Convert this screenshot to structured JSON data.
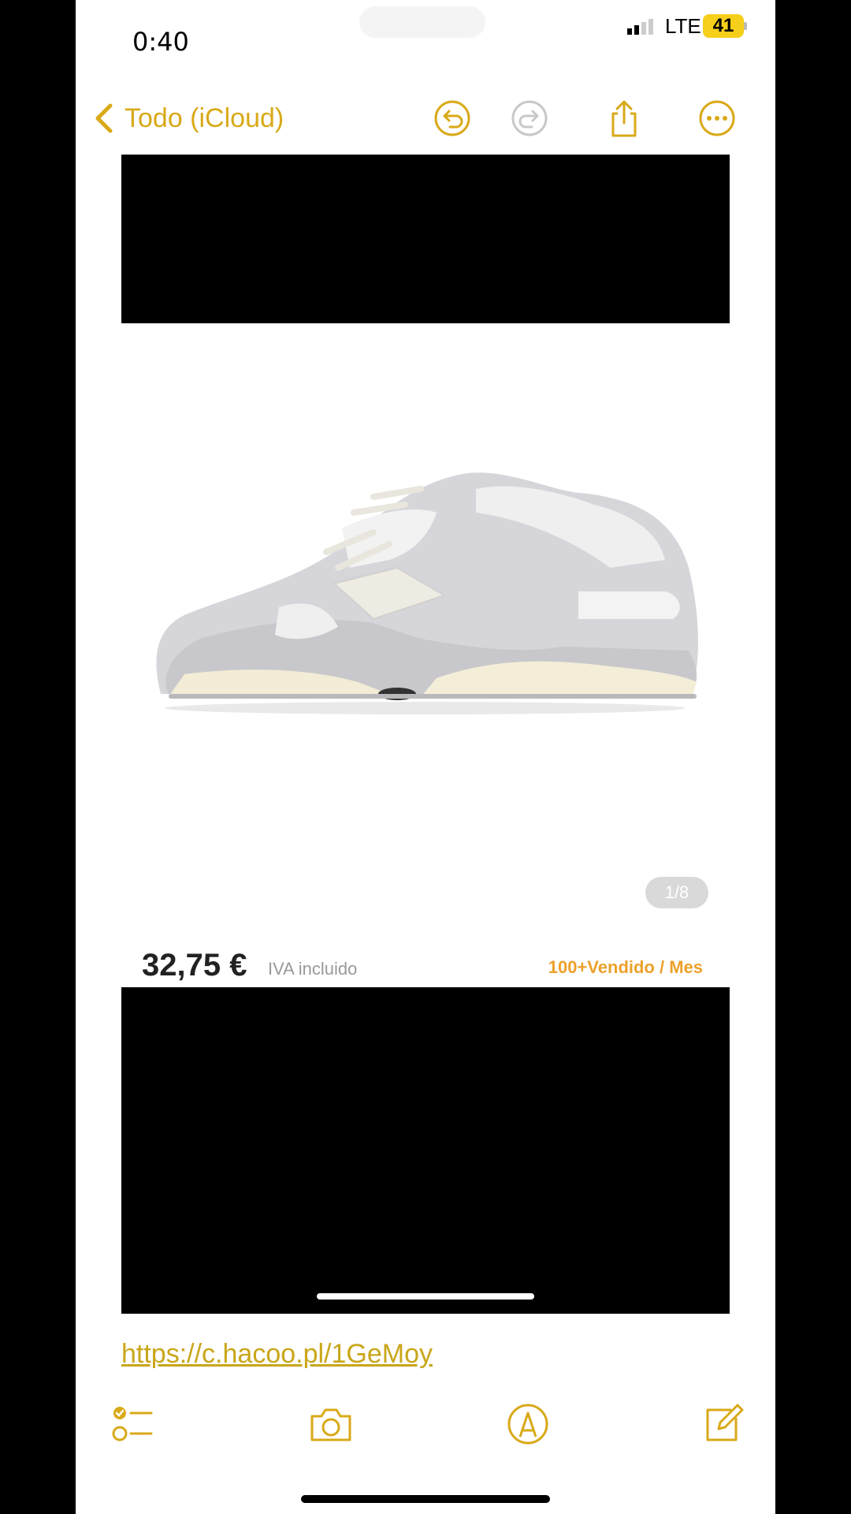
{
  "status": {
    "time": "0:40",
    "network": "LTE",
    "battery": "41"
  },
  "nav": {
    "back_label": "Todo (iCloud)"
  },
  "product": {
    "pager": "1/8",
    "price": "32,75 €",
    "vat": "IVA incluido",
    "sold": "100+Vendido / Mes"
  },
  "link": "https://c.hacoo.pl/1GeMoy",
  "colors": {
    "accent": "#d9a918",
    "sold": "#eca12b",
    "battery": "#f5cf19"
  }
}
